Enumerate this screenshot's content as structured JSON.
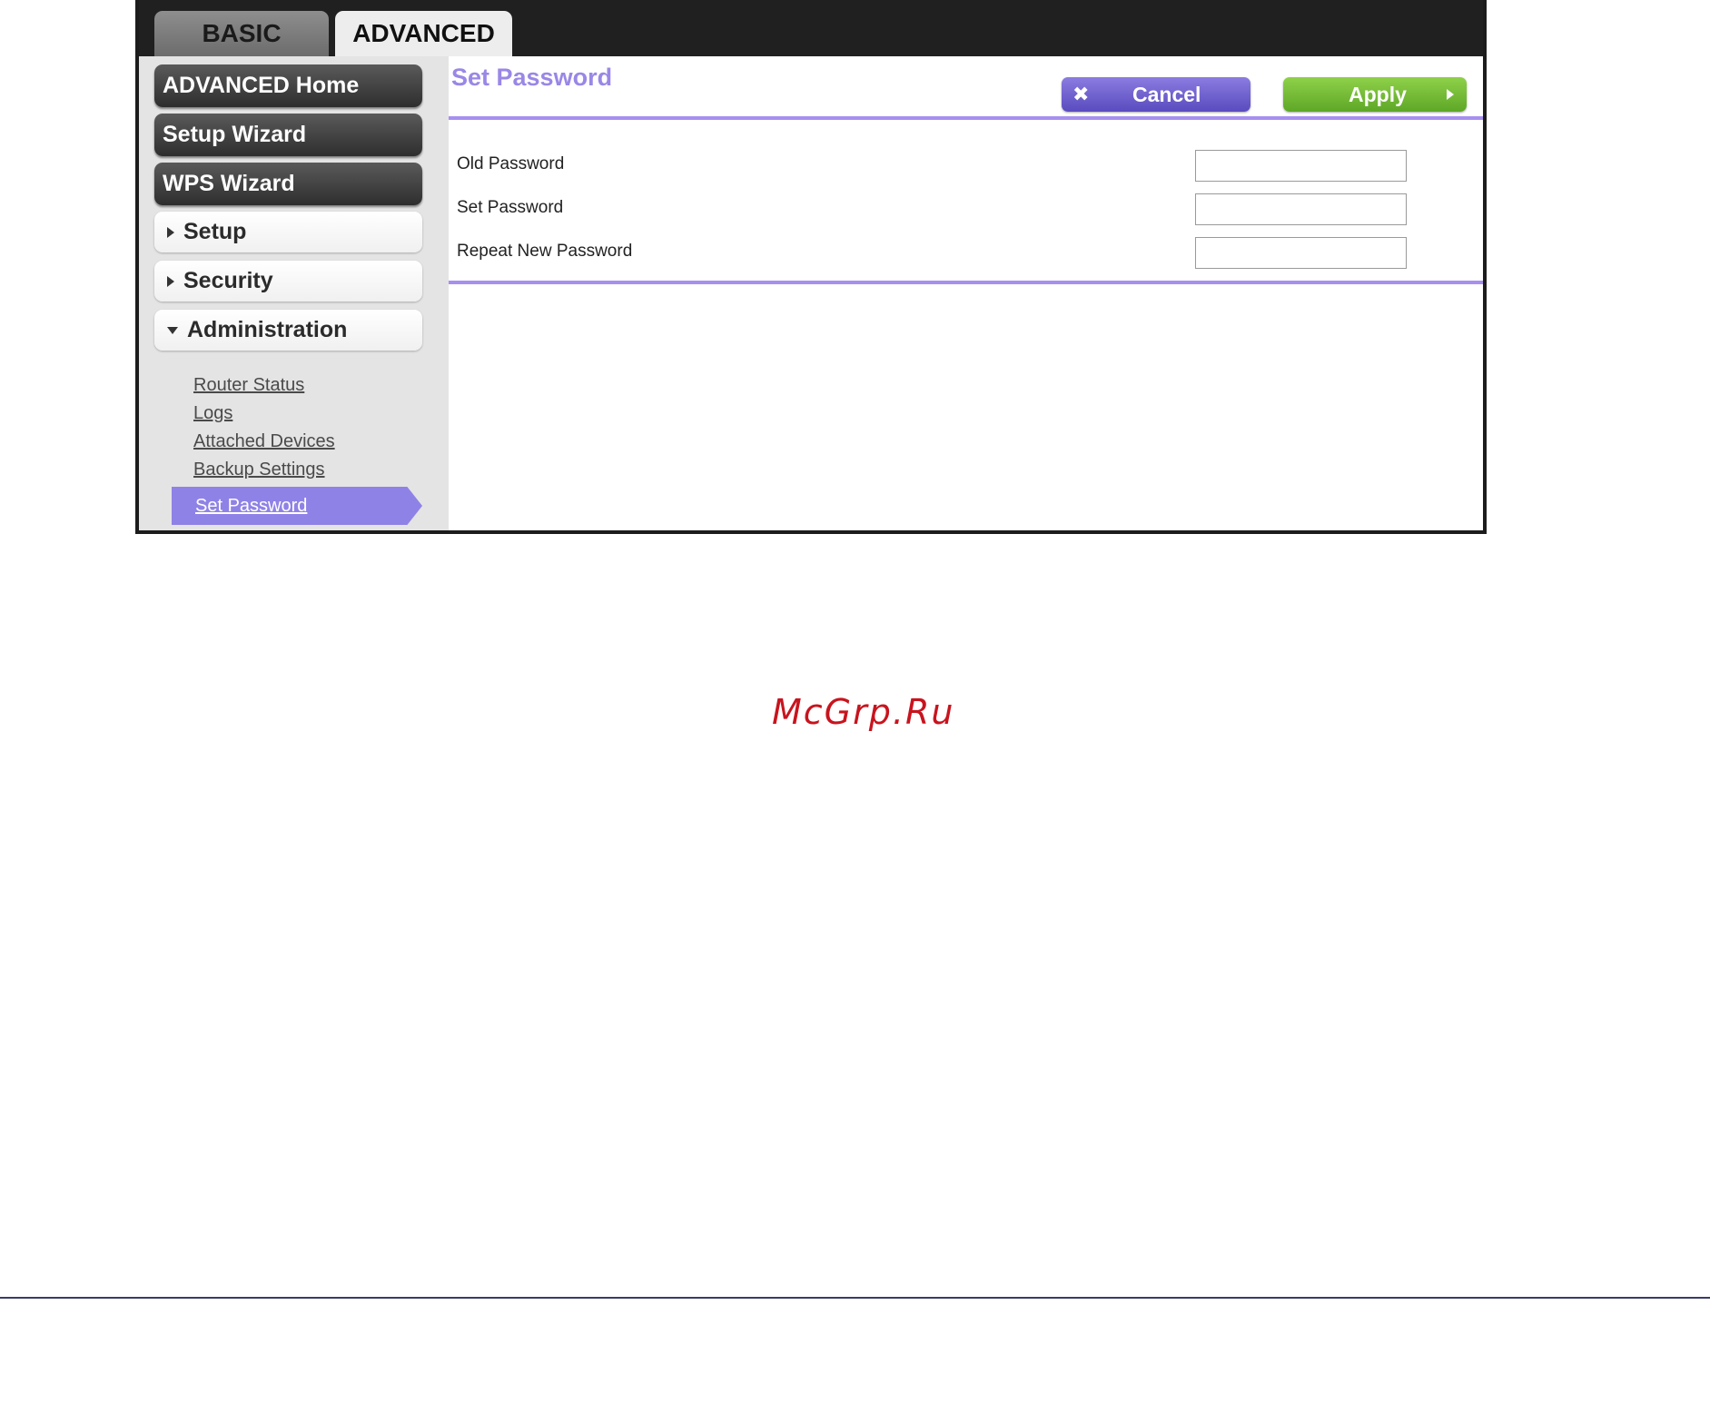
{
  "tabs": {
    "basic": "BASIC",
    "advanced": "ADVANCED"
  },
  "sidebar": {
    "advanced_home": "ADVANCED Home",
    "setup_wizard": "Setup Wizard",
    "wps_wizard": "WPS Wizard",
    "setup": "Setup",
    "security": "Security",
    "administration": "Administration",
    "admin_items": [
      "Router Status",
      "Logs",
      "Attached Devices",
      "Backup Settings",
      "Set Password"
    ],
    "active_item": "Set Password"
  },
  "main": {
    "title": "Set Password",
    "cancel_label": "Cancel",
    "apply_label": "Apply",
    "fields": [
      {
        "label": "Old Password",
        "value": ""
      },
      {
        "label": "Set Password",
        "value": ""
      },
      {
        "label": "Repeat New Password",
        "value": ""
      }
    ]
  },
  "watermark": "McGrp.Ru",
  "colors": {
    "accent_purple": "#9a87e6",
    "apply_green": "#6ab833",
    "cancel_purple": "#6a5bd0",
    "active_item": "#8f82e6",
    "watermark_red": "#c8141e"
  }
}
